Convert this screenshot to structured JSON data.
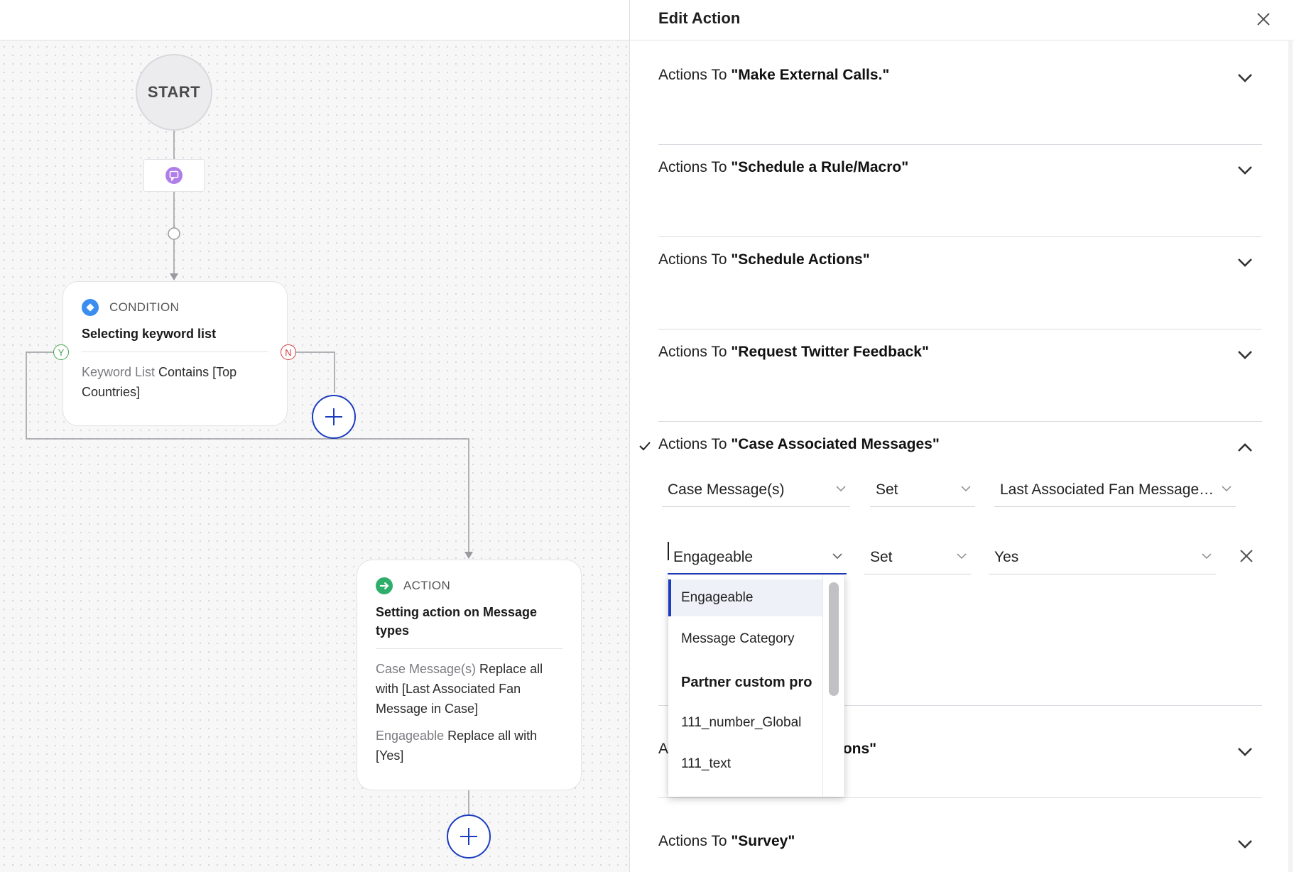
{
  "canvas": {
    "start_label": "START",
    "condition_node": {
      "type_label": "CONDITION",
      "title": "Selecting keyword list",
      "field": "Keyword List",
      "rest": " Contains [Top Countries]"
    },
    "yes_badge": "Y",
    "no_badge": "N",
    "action_node": {
      "type_label": "ACTION",
      "title": "Setting action on Message types",
      "line1_field": "Case Message(s)",
      "line1_rest": " Replace all with [Last Associated Fan Message in Case]",
      "line2_field": "Engageable",
      "line2_rest": " Replace all with [Yes]"
    }
  },
  "panel": {
    "title": "Edit Action",
    "sections": [
      {
        "prefix": "Actions To ",
        "name": "\"Make External Calls.\""
      },
      {
        "prefix": "Actions To ",
        "name": "\"Schedule a Rule/Macro\""
      },
      {
        "prefix": "Actions To ",
        "name": "\"Schedule Actions\""
      },
      {
        "prefix": "Actions To ",
        "name": "\"Request Twitter Feedback\""
      },
      {
        "prefix": "Actions To ",
        "name": "\"Case Associated Messages\""
      },
      {
        "prefix": "A",
        "name": "tions\""
      },
      {
        "prefix": "Actions To ",
        "name": "\"Survey\""
      }
    ],
    "rows": [
      {
        "field": "Case Message(s)",
        "operator": "Set",
        "value": "Last Associated Fan Message i..."
      },
      {
        "field": "Engageable",
        "operator": "Set",
        "value": "Yes"
      }
    ],
    "dropdown": {
      "options": [
        "Engageable",
        "Message Category"
      ],
      "group_label": "Partner custom pro",
      "group_options": [
        "111_number_Global",
        "111_text"
      ]
    }
  },
  "colors": {
    "accent": "#1b3cbf",
    "condition_icon": "#3b8ef0",
    "action_icon": "#2fae6b",
    "yes": "#47a34a",
    "no": "#d63b3b",
    "channel_icon": "#b07ee8"
  }
}
